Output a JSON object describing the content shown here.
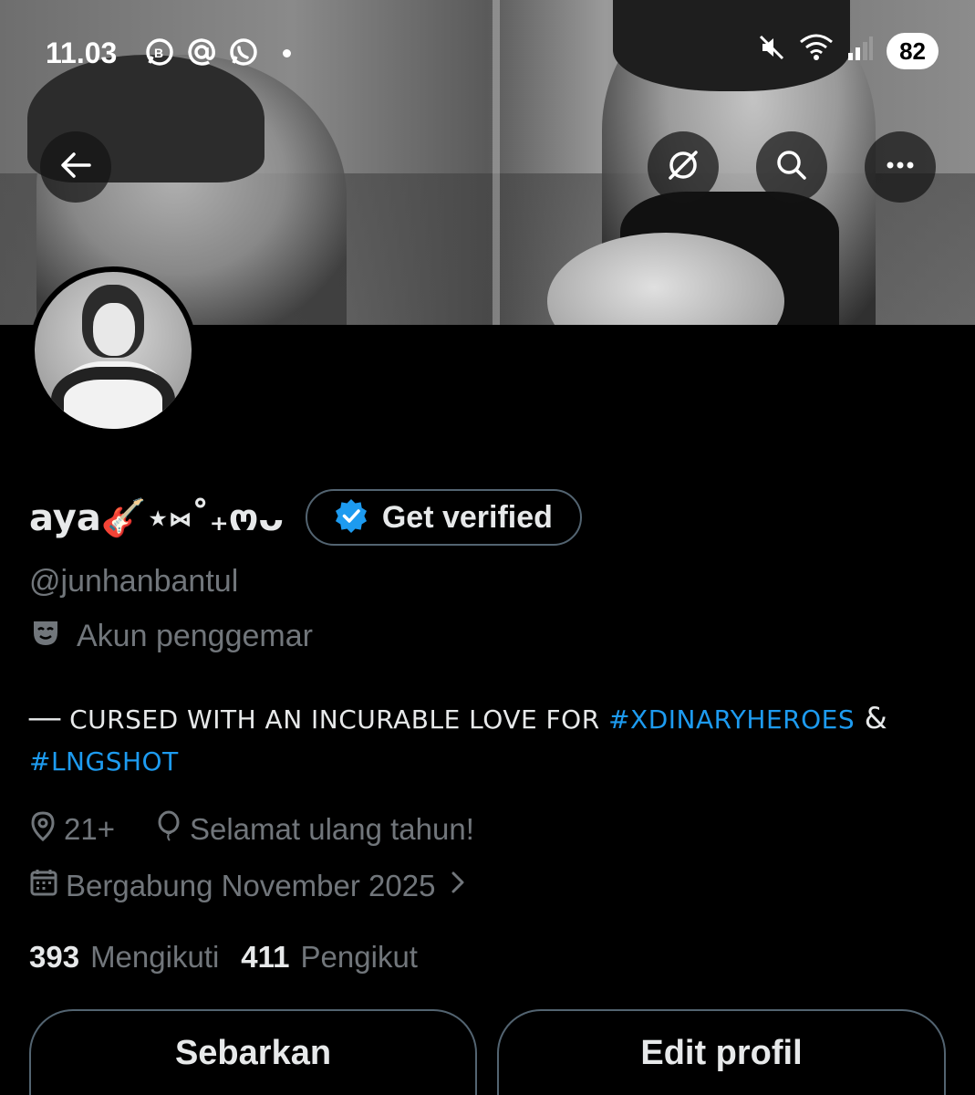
{
  "status_bar": {
    "time": "11.03",
    "icons": [
      "whatsapp-business-icon",
      "at-icon",
      "whatsapp-icon",
      "notification-dot"
    ],
    "right_icons": [
      "mute-icon",
      "wifi-icon",
      "signal-icon"
    ],
    "battery": "82"
  },
  "header": {
    "back_icon": "back-arrow-icon",
    "actions": [
      "grok-icon",
      "search-icon",
      "more-icon"
    ]
  },
  "profile": {
    "display_name": "aya🎸⋆⑅˚₊ოᴗ",
    "get_verified_label": "Get verified",
    "handle": "@junhanbantul",
    "category": "Akun penggemar",
    "bio_text": "── CURSED WITH AN INCURABLE LOVE FOR ",
    "bio_tag1": "#XDINARYHEROES",
    "bio_amp": " & ",
    "bio_tag2": "#LNGSHOT",
    "location": "21+",
    "birthday": "Selamat ulang tahun!",
    "joined": "Bergabung November 2025",
    "following_count": "393",
    "following_label": "Mengikuti",
    "followers_count": "411",
    "followers_label": "Pengikut"
  },
  "buttons": {
    "share": "Sebarkan",
    "edit": "Edit profil"
  },
  "colors": {
    "background": "#000000",
    "text_primary": "#e7e9ea",
    "text_secondary": "#71767b",
    "link": "#1d9bf0",
    "border": "#536471",
    "verified_badge": "#1d9bf0"
  }
}
